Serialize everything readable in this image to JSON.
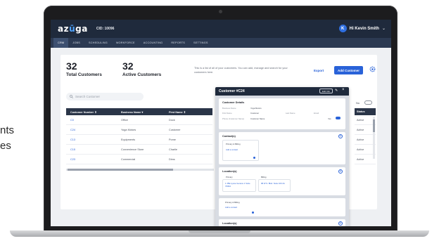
{
  "side_text": [
    "nts",
    "es"
  ],
  "app": {
    "logo_main": "az",
    "logo_accent": "ū",
    "logo_tail": "ga",
    "cid": "CID: 10096",
    "user_initial": "K",
    "greeting": "Hi Kevin Smith"
  },
  "nav": [
    "CRM",
    "JOBS",
    "SCHEDULING",
    "WORKFORCE",
    "ACCOUNTING",
    "REPORTS",
    "SETTINGS"
  ],
  "stats": {
    "total_value": "32",
    "total_label": "Total Customers",
    "active_value": "32",
    "active_label": "Active Customers"
  },
  "description": "This is a list of all of your customers. You can add, manage and search for your customers here.",
  "actions": {
    "export": "Export",
    "add": "Add Customer"
  },
  "search": {
    "placeholder": "Search Customer"
  },
  "table": {
    "headers": [
      "Customer Number",
      "Business Name",
      "First Name"
    ],
    "sort_marks": [
      "⇕",
      "▾",
      "⇕"
    ],
    "rows": [
      [
        "C0",
        "Office",
        "Dock"
      ],
      [
        "C24",
        "Yoga Motors",
        "Customer"
      ],
      [
        "C13",
        "Equipments",
        "Pome"
      ],
      [
        "C15",
        "Convenience Store",
        "Charlie"
      ],
      [
        "C23",
        "Commercial",
        "Dims"
      ]
    ],
    "status_header": "Status",
    "status_values": [
      "Active",
      "Active",
      "Active",
      "Active",
      "Active"
    ],
    "toggle_label": "No"
  },
  "panel": {
    "title": "Customer #C24",
    "edit_label": "Edit Info",
    "details_title": "Customer Details",
    "fields": [
      {
        "label": "Business Name",
        "value": "Yoga Motors"
      },
      {
        "label": "First Name",
        "value": "Customer"
      },
      {
        "label": "Phone (Customer Name)",
        "value": "Customer Name"
      }
    ],
    "columns": [
      "Last Name",
      "Email"
    ],
    "toggle_text": "Yes",
    "contacts_title": "Contact(s)",
    "contact_primary": "Primary & Billing",
    "contact_link": "Add a contact",
    "location_title": "Location(s)",
    "location_primary": "Primary",
    "location_billing": "Billing",
    "location_addr1": "1 45E Lycée Genève 1 Suite 7000A",
    "location_addr2": "98 W S. Blvd. Suite 100 2A",
    "contact2_title": "Primary & Billing",
    "contact2_link": "Add a contact",
    "location2_title": "Location(s)"
  }
}
